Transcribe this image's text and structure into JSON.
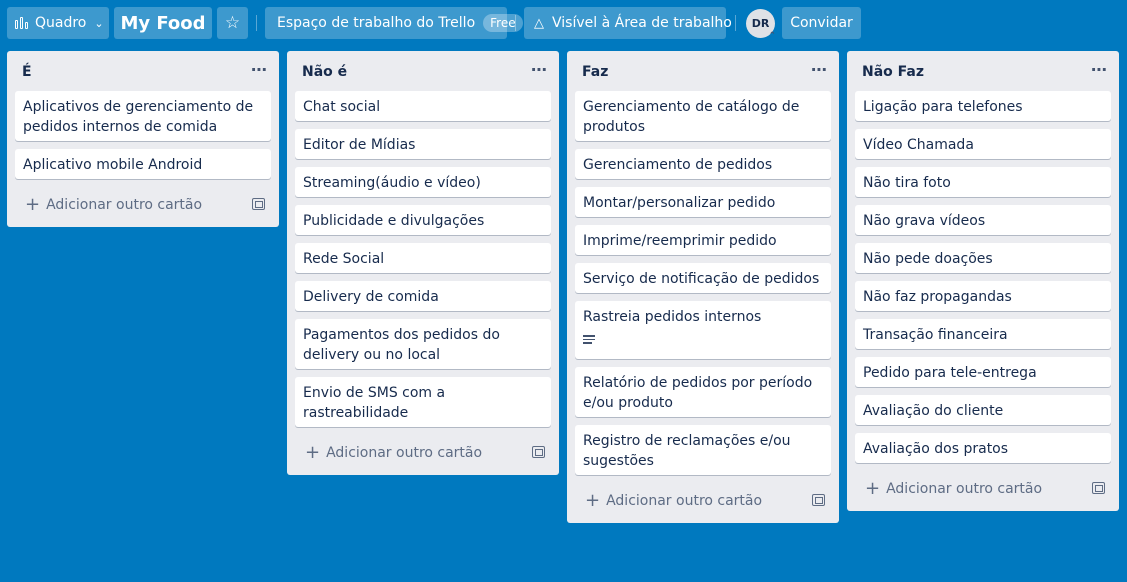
{
  "header": {
    "view_label": "Quadro",
    "board_title": "My Food",
    "workspace_label": "Espaço de trabalho do Trello",
    "workspace_badge": "Free",
    "visibility_label": "Visível à Área de trabalho",
    "avatar_initials": "DR",
    "invite_label": "Convidar"
  },
  "lists": [
    {
      "title": "É",
      "cards": [
        "Aplicativos de gerenciamento de pedidos internos de comida",
        "Aplicativo mobile Android"
      ],
      "add_label": "Adicionar outro cartão"
    },
    {
      "title": "Não é",
      "cards": [
        "Chat social",
        "Editor de Mídias",
        "Streaming(áudio e vídeo)",
        "Publicidade e divulgações",
        "Rede Social",
        "Delivery de comida",
        "Pagamentos dos pedidos do delivery ou no local",
        "Envio de SMS com a rastreabilidade"
      ],
      "add_label": "Adicionar outro cartão"
    },
    {
      "title": "Faz",
      "cards": [
        "Gerenciamento de catálogo de produtos",
        "Gerenciamento de pedidos",
        "Montar/personalizar pedido",
        "Imprime/reemprimir pedido",
        "Serviço de notificação de pedidos",
        "Rastreia pedidos internos",
        "Relatório de pedidos por período e/ou produto",
        "Registro de reclamações e/ou sugestões"
      ],
      "add_label": "Adicionar outro cartão"
    },
    {
      "title": "Não Faz",
      "cards": [
        "Ligação para telefones",
        "Vídeo Chamada",
        "Não tira foto",
        "Não grava vídeos",
        "Não pede doações",
        "Não faz propagandas",
        "Transação financeira",
        "Pedido para tele-entrega",
        "Avaliação do cliente",
        "Avaliação dos pratos"
      ],
      "add_label": "Adicionar outro cartão"
    }
  ]
}
